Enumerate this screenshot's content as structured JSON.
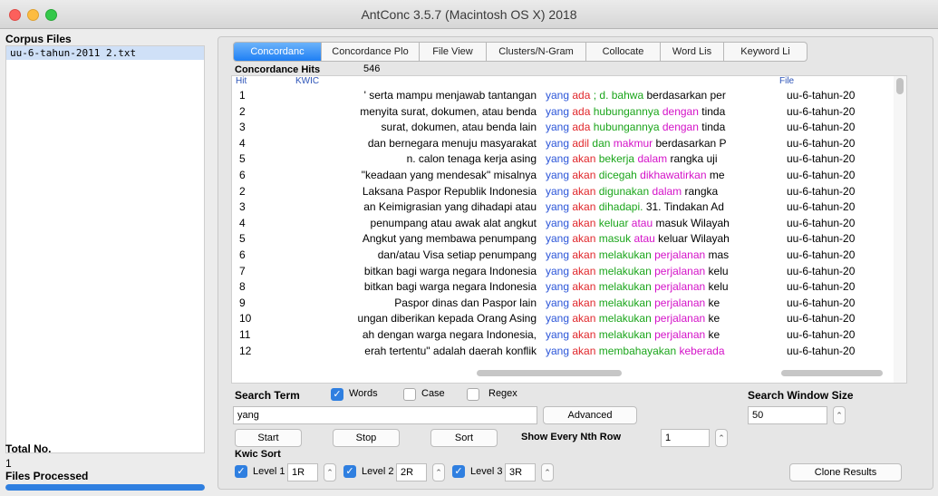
{
  "window": {
    "title": "AntConc 3.5.7 (Macintosh OS X) 2018"
  },
  "sidebar": {
    "corpus_files_label": "Corpus Files",
    "files": [
      "uu-6-tahun-2011 2.txt"
    ],
    "total_label": "Total No.",
    "total_count": "1",
    "processed_label": "Files Processed",
    "progress": 1.0
  },
  "tabs": [
    {
      "label": "Concordanc",
      "active": true
    },
    {
      "label": "Concordance Plo",
      "active": false
    },
    {
      "label": "File View",
      "active": false
    },
    {
      "label": "Clusters/N-Gram",
      "active": false
    },
    {
      "label": "Collocate",
      "active": false
    },
    {
      "label": "Word Lis",
      "active": false
    },
    {
      "label": "Keyword Li",
      "active": false
    }
  ],
  "hits": {
    "label": "Concordance Hits",
    "count": "546"
  },
  "columns": {
    "hit": "Hit",
    "kwic": "KWIC",
    "file": "File"
  },
  "rows": [
    {
      "hit": "1",
      "left": "' serta mampu menjawab tantangan",
      "kw": "yang",
      "r1": "ada",
      "r2": "; d. bahwa",
      "r3": "",
      "rest": "berdasarkan per",
      "file": "uu-6-tahun-20"
    },
    {
      "hit": "2",
      "left": "menyita surat, dokumen, atau benda",
      "kw": "yang",
      "r1": "ada",
      "r2": "hubungannya",
      "r3": "dengan",
      "rest": "tinda",
      "file": "uu-6-tahun-20"
    },
    {
      "hit": "3",
      "left": "surat, dokumen, atau benda lain",
      "kw": "yang",
      "r1": "ada",
      "r2": "hubungannya",
      "r3": "dengan",
      "rest": "tinda",
      "file": "uu-6-tahun-20"
    },
    {
      "hit": "4",
      "left": "dan  bernegara menuju masyarakat",
      "kw": "yang",
      "r1": "adil",
      "r2": "dan",
      "r3": "makmur",
      "rest": "berdasarkan P",
      "file": "uu-6-tahun-20"
    },
    {
      "hit": "5",
      "left": "n. calon tenaga kerja asing",
      "kw": "yang",
      "r1": "akan",
      "r2": "bekerja",
      "r3": "dalam",
      "rest": "rangka  uji",
      "file": "uu-6-tahun-20"
    },
    {
      "hit": "6",
      "left": "\"keadaan yang mendesak\" misalnya",
      "kw": "yang",
      "r1": "akan",
      "r2": "dicegah",
      "r3": "dikhawatirkan",
      "rest": "me",
      "file": "uu-6-tahun-20"
    },
    {
      "hit": "2",
      "left": "Laksana Paspor Republik Indonesia",
      "kw": "yang",
      "r1": "akan",
      "r2": "digunakan",
      "r3": "dalam",
      "rest": "rangka",
      "file": "uu-6-tahun-20"
    },
    {
      "hit": "3",
      "left": "an Keimigrasian  yang dihadapi atau",
      "kw": "yang",
      "r1": "akan",
      "r2": "dihadapi.",
      "r3": "",
      "rest": "31. Tindakan Ad",
      "file": "uu-6-tahun-20"
    },
    {
      "hit": "4",
      "left": "penumpang atau awak alat angkut",
      "kw": "yang",
      "r1": "akan",
      "r2": "keluar",
      "r3": "atau",
      "rest": "masuk Wilayah",
      "file": "uu-6-tahun-20"
    },
    {
      "hit": "5",
      "left": "Angkut yang membawa  penumpang",
      "kw": "yang",
      "r1": "akan",
      "r2": "masuk",
      "r3": "atau",
      "rest": "keluar Wilayah",
      "file": "uu-6-tahun-20"
    },
    {
      "hit": "6",
      "left": "dan/atau Visa setiap  penumpang",
      "kw": "yang",
      "r1": "akan",
      "r2": "melakukan",
      "r3": "perjalanan",
      "rest": "mas",
      "file": "uu-6-tahun-20"
    },
    {
      "hit": "7",
      "left": "bitkan bagi warga negara  Indonesia",
      "kw": "yang",
      "r1": "akan",
      "r2": "melakukan",
      "r3": "perjalanan",
      "rest": "kelu",
      "file": "uu-6-tahun-20"
    },
    {
      "hit": "8",
      "left": "bitkan bagi warga negara Indonesia",
      "kw": "yang",
      "r1": "akan",
      "r2": "melakukan",
      "r3": "perjalanan",
      "rest": "kelu",
      "file": "uu-6-tahun-20"
    },
    {
      "hit": "9",
      "left": "Paspor dinas dan Paspor lain",
      "kw": "yang",
      "r1": "akan",
      "r2": "melakukan",
      "r3": "perjalanan",
      "rest": "ke",
      "file": "uu-6-tahun-20"
    },
    {
      "hit": "10",
      "left": "ungan diberikan kepada Orang Asing",
      "kw": "yang",
      "r1": "akan",
      "r2": "melakukan",
      "r3": "perjalanan",
      "rest": "ke",
      "file": "uu-6-tahun-20"
    },
    {
      "hit": "11",
      "left": "ah dengan warga  negara Indonesia,",
      "kw": "yang",
      "r1": "akan",
      "r2": "melakukan",
      "r3": "perjalanan",
      "rest": "ke",
      "file": "uu-6-tahun-20"
    },
    {
      "hit": "12",
      "left": "erah tertentu\" adalah daerah konflik",
      "kw": "yang",
      "r1": "akan",
      "r2": "membahayakan",
      "r3": "keberada",
      "rest": "",
      "file": "uu-6-tahun-20"
    }
  ],
  "search": {
    "term_label": "Search Term",
    "words_label": "Words",
    "case_label": "Case",
    "regex_label": "Regex",
    "value": "yang",
    "advanced_label": "Advanced",
    "window_size_label": "Search Window Size",
    "window_size_value": "50"
  },
  "controls": {
    "start": "Start",
    "stop": "Stop",
    "sort": "Sort",
    "nth_label": "Show Every Nth Row",
    "nth_value": "1"
  },
  "kwic_sort": {
    "label": "Kwic Sort",
    "level1_label": "Level 1",
    "level1_value": "1R",
    "level2_label": "Level 2",
    "level2_value": "2R",
    "level3_label": "Level 3",
    "level3_value": "3R",
    "clone_label": "Clone Results"
  },
  "colors": {
    "accent": "#2f7fe0",
    "keyword": "#2b55d8",
    "r1": "#e0262a",
    "r2": "#1aa51a",
    "r3": "#d412c8"
  }
}
